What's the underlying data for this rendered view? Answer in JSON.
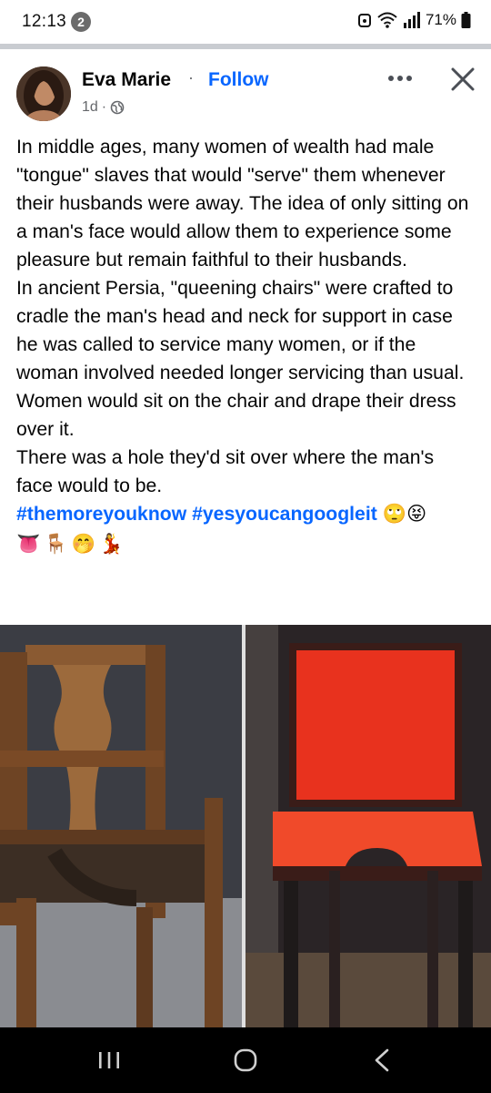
{
  "status_bar": {
    "time": "12:13",
    "notification_count": "2",
    "battery": "71%"
  },
  "post": {
    "author": {
      "name": "Eva Marie",
      "separator": "·",
      "follow_label": "Follow"
    },
    "meta": {
      "age": "1d",
      "dot": "·",
      "audience_icon": "globe-icon"
    },
    "paragraphs": [
      "In middle ages, many women of wealth had male \"tongue\" slaves that would \"serve\" them whenever their husbands were away. The idea of only sitting on a man's face would allow them to experience some pleasure but remain faithful to their husbands.",
      "In ancient Persia, \"queening chairs\" were crafted to cradle the man's head and neck for support in case he was called to service many women, or if the woman involved needed longer servicing than usual.",
      "Women would sit on the chair and drape their dress over it.",
      "There was a hole they'd sit over where the man's face would to be."
    ],
    "hashtags": [
      "#themoreyouknow",
      "#yesyoucangoogleit"
    ],
    "emojis_line1": [
      "🙄",
      "😝"
    ],
    "emojis_line2": [
      "👅",
      "🪑",
      "🤭",
      "💃"
    ]
  },
  "icons": {
    "more": "more-options-icon",
    "close": "close-icon",
    "nav_recents": "recents-icon",
    "nav_home": "home-icon",
    "nav_back": "back-icon"
  },
  "colors": {
    "link_blue": "#0866ff",
    "secondary_text": "#65676b",
    "chair_red": "#e8321e",
    "chair_wood": "#7a4a26"
  }
}
